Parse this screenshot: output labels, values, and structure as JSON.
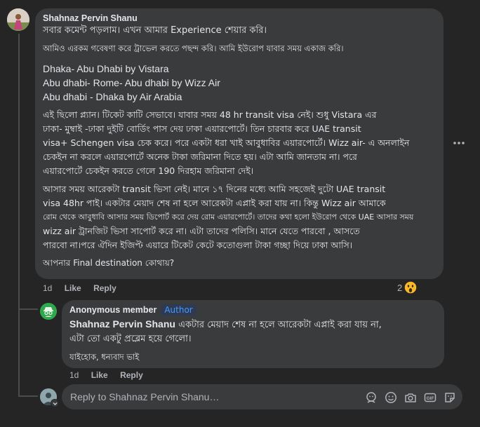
{
  "comment": {
    "author": "Shahnaz Pervin Shanu",
    "paragraphs": [
      [
        "সবার কমেন্ট পড়লাম। এখন আমার Experience শেয়ার করি।"
      ],
      [
        "আমিও এরকম গবেষণা করে ট্রাভেল করতে পছন্দ করি। আমি ইউরোপ যাবার সময় একাজ করি।"
      ],
      [
        "Dhaka- Abu Dhabi by Vistara",
        "Abu dhabi- Rome- Abu dhabi by Wizz Air",
        "Abu dhabi - Dhaka by Air Arabia"
      ],
      [
        "এই ছিলো প্ল্যান। টিকেট কাটি সেভাবে। যাবার সময় 48 hr transit visa নেই। শুধু Vistara এর",
        "ঢাকা- মুম্বাই -ঢাকা দুইটি বোর্ডিং পাস দেয় ঢাকা এয়ারপোর্টে। তিন চারবার করে UAE transit",
        "visa+ Schengen visa চেক করে। পরে একটা ধরা খাই আবুধাবির এয়ারপোর্টে। Wizz air- এ অনলাইন",
        "চেকইন না করলে এয়ারপোর্টে অনেক টাকা জরিমানা দিতে হয়। এটা আমি জানতাম না। পরে",
        "এয়ারপোর্টে চেকইন করতে গেলে 190 দিরহাম জরিমানা দেই।"
      ],
      [
        "আসার সময় আরেকটা transit ভিসা নেই। মানে ১৭ দিনের মধ্যে আমি সহজেই দুটো UAE transit",
        "visa 48hr পাই। একটার মেয়াদ শেষ না হলে আরেকটা এপ্লাই করা যায় না। কিন্তু Wizz air আমাকে",
        "রোম থেকে আবুধাবি আসার সময় ডিপোর্ট করে দেয় রোম এয়ারপোর্টে। তাদের কথা হলো ইউরোপ থেকে UAE আসার সময়",
        "wizz air ট্রানজিট ভিসা সাপোর্ট করে না। এটা তাদের পলিসি। মানে যেতে পারবো , আসতে",
        "পারবো না।পরে ঐদিন ইজিপ্ট এয়ারে টিকেট কেটে কতোগুলা টাকা গচ্ছা দিয়ে ঢাকা আসি।"
      ],
      [
        "আপনার Final destination কোথায়?"
      ]
    ],
    "time": "1d",
    "like_label": "Like",
    "reply_label": "Reply",
    "reaction_count": "2",
    "more_label": "More options"
  },
  "reply": {
    "author": "Anonymous member",
    "badge": "Author",
    "mention": "Shahnaz Pervin Shanu",
    "line1_rest": " একটার মেয়াদ শেষ না হলে আরেকটা এপ্লাই করা যায় না,",
    "line2": "এটা তো একটু প্রব্লেম হয়ে গেলো।",
    "line3": "যাইহোক, ধন্যবাদ ভাই",
    "time": "1d",
    "like_label": "Like",
    "reply_label": "Reply"
  },
  "composer": {
    "placeholder": "Reply to Shahnaz Pervin Shanu…",
    "icons": [
      "avatar-sticker-icon",
      "emoji-icon",
      "camera-icon",
      "gif-icon",
      "sticker-icon"
    ]
  },
  "colors": {
    "background": "#252526",
    "bubble": "#3a3b3c",
    "text": "#e4e6eb",
    "muted": "#b0b3b8",
    "badge_text": "#4599ff",
    "badge_bg": "#2d3a52"
  }
}
